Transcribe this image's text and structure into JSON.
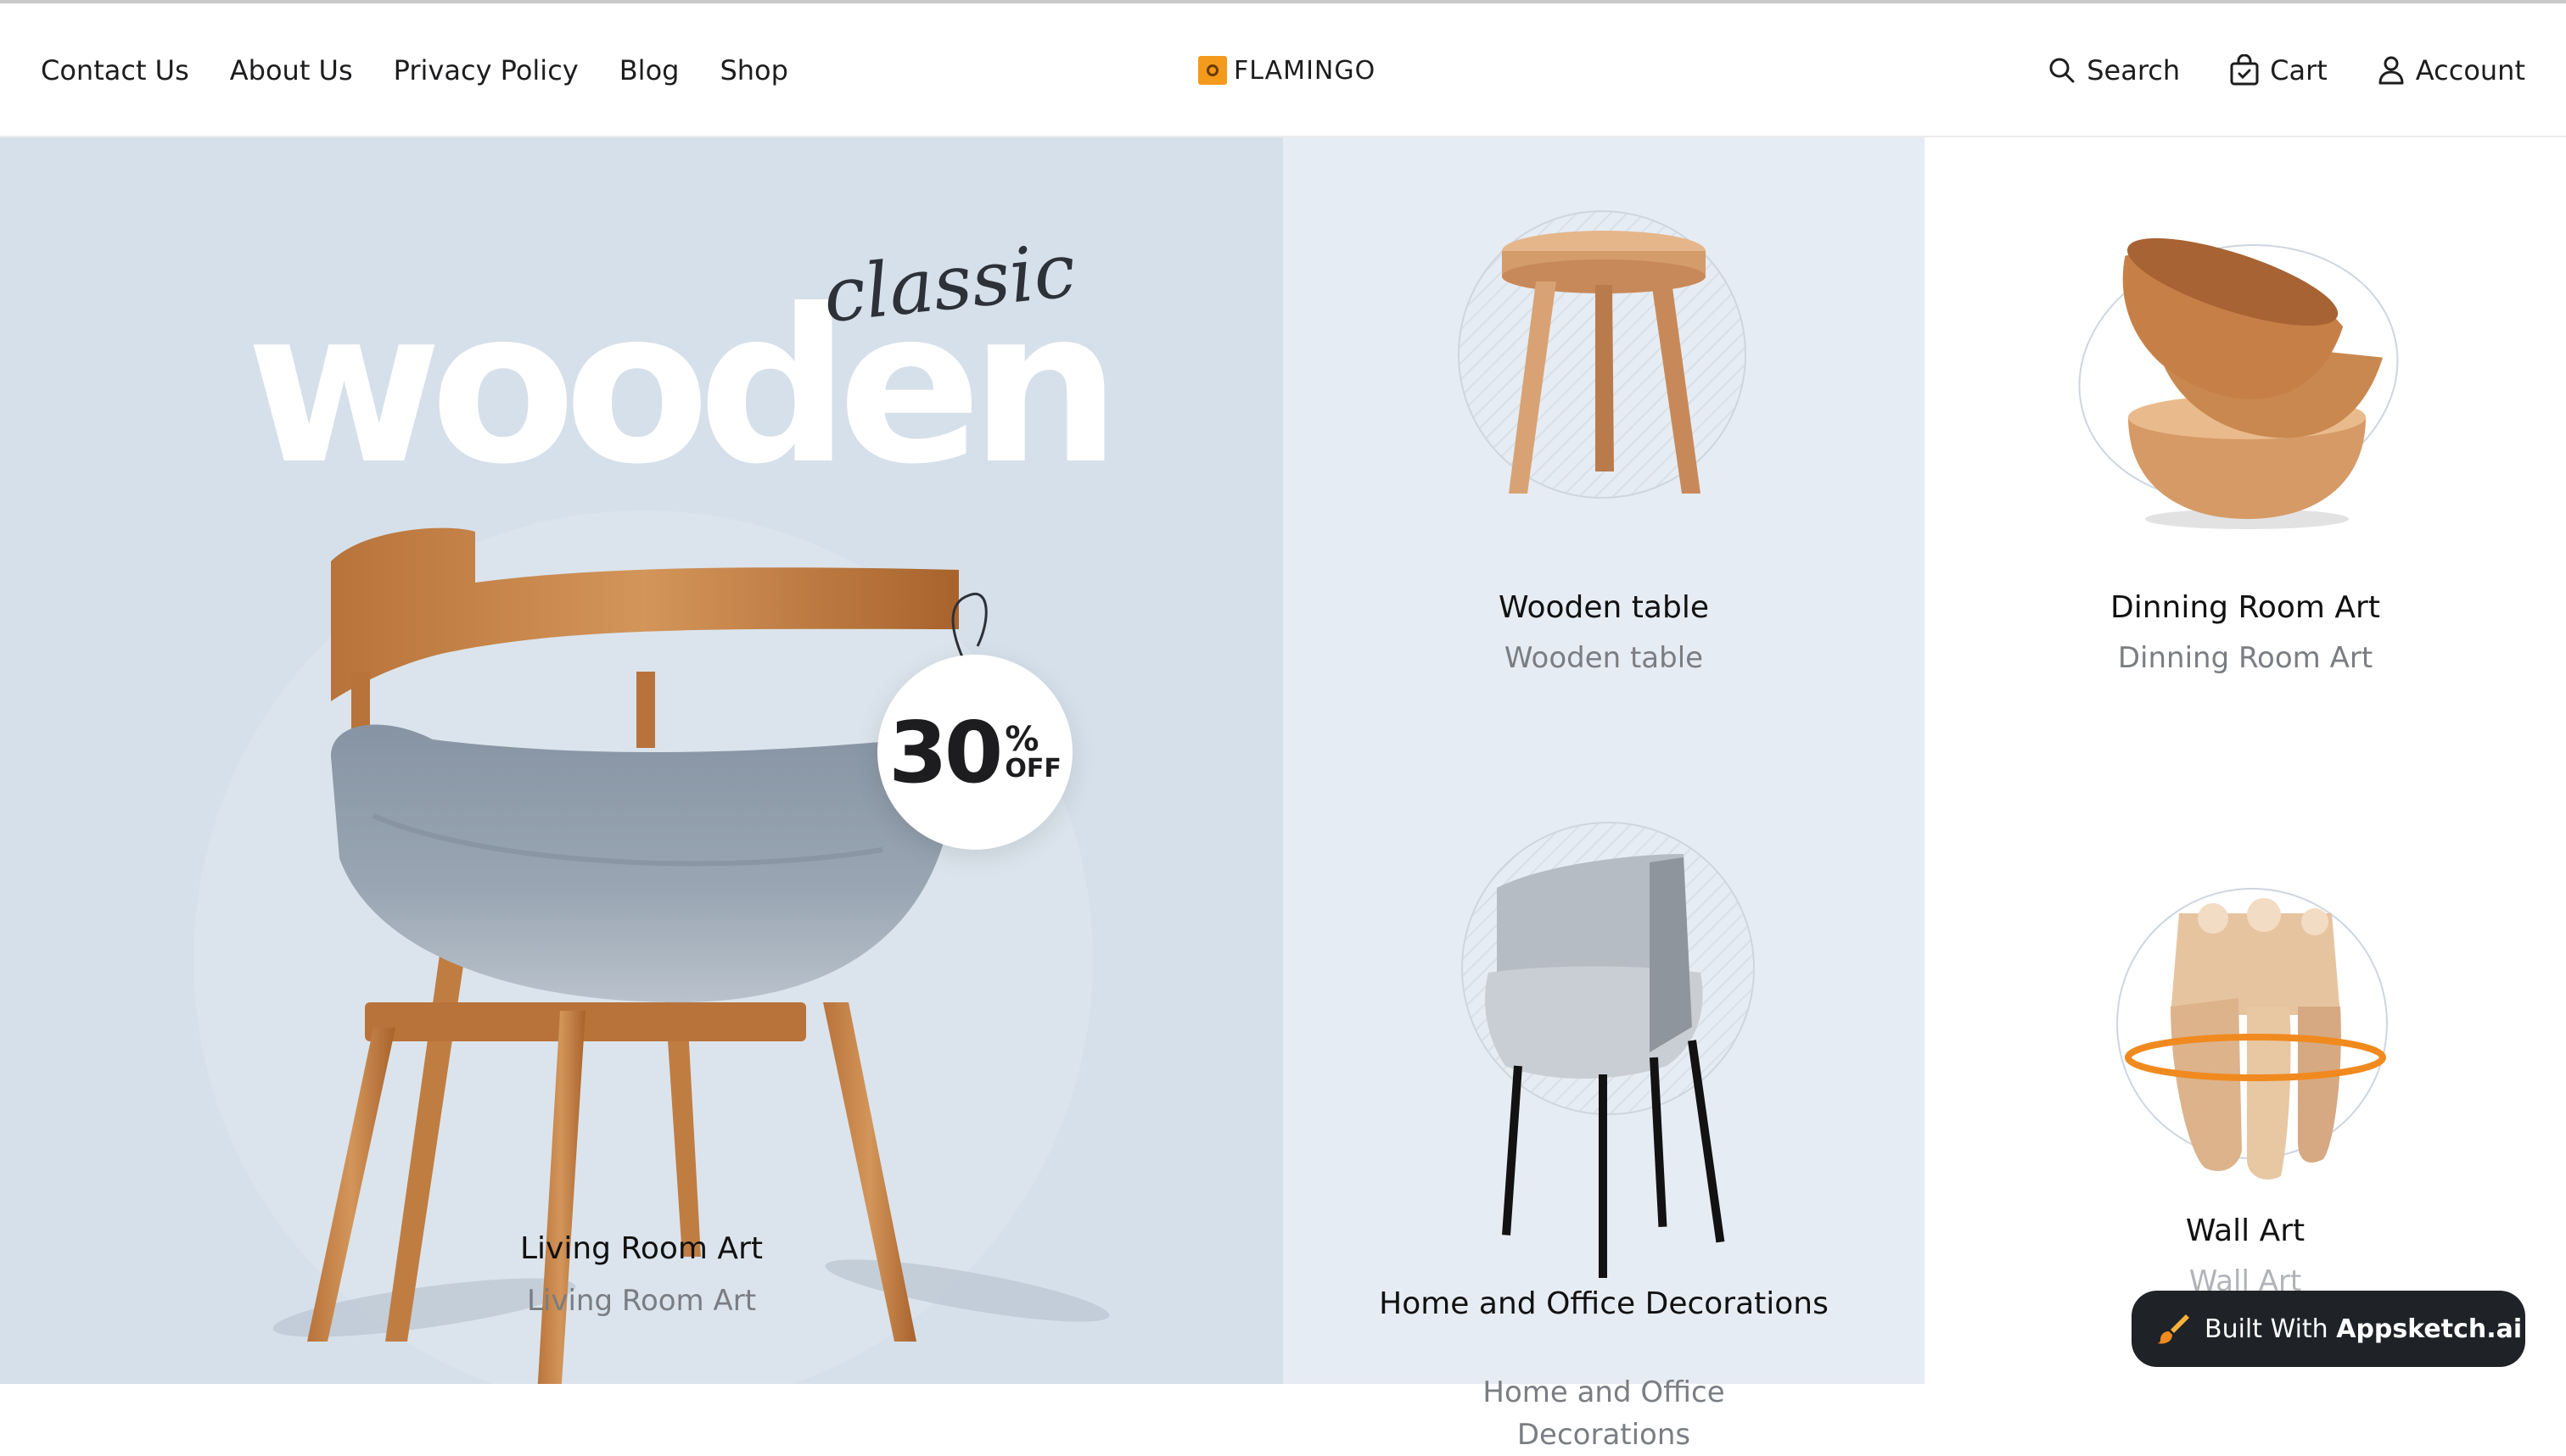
{
  "nav": {
    "left": [
      "Contact Us",
      "About Us",
      "Privacy Policy",
      "Blog",
      "Shop"
    ],
    "brand": "FLAMINGO",
    "right": {
      "search": "Search",
      "cart": "Cart",
      "account": "Account"
    }
  },
  "hero": {
    "headline": "wooden",
    "script": "classic",
    "badge_value": "30",
    "badge_percent": "%",
    "badge_off": "OFF",
    "title": "Living Room Art",
    "subtitle": "Living Room Art"
  },
  "cards": [
    {
      "title": "Wooden table",
      "subtitle": "Wooden table"
    },
    {
      "title": "Dinning Room Art",
      "subtitle": "Dinning Room Art"
    },
    {
      "title": "Home and Office Decorations",
      "subtitle": "Home and Office Decorations"
    },
    {
      "title": "Wall Art",
      "subtitle": "Wall Art"
    }
  ],
  "built_with": {
    "prefix": "Built With",
    "brand": "Appsketch.ai"
  },
  "colors": {
    "accent": "#f39a1d",
    "hero_bg": "#d6e0ea",
    "col2_bg": "#e6ecf3",
    "dark": "#1f2328"
  },
  "icons": [
    "search-icon",
    "cart-icon",
    "account-icon",
    "brush-icon"
  ]
}
